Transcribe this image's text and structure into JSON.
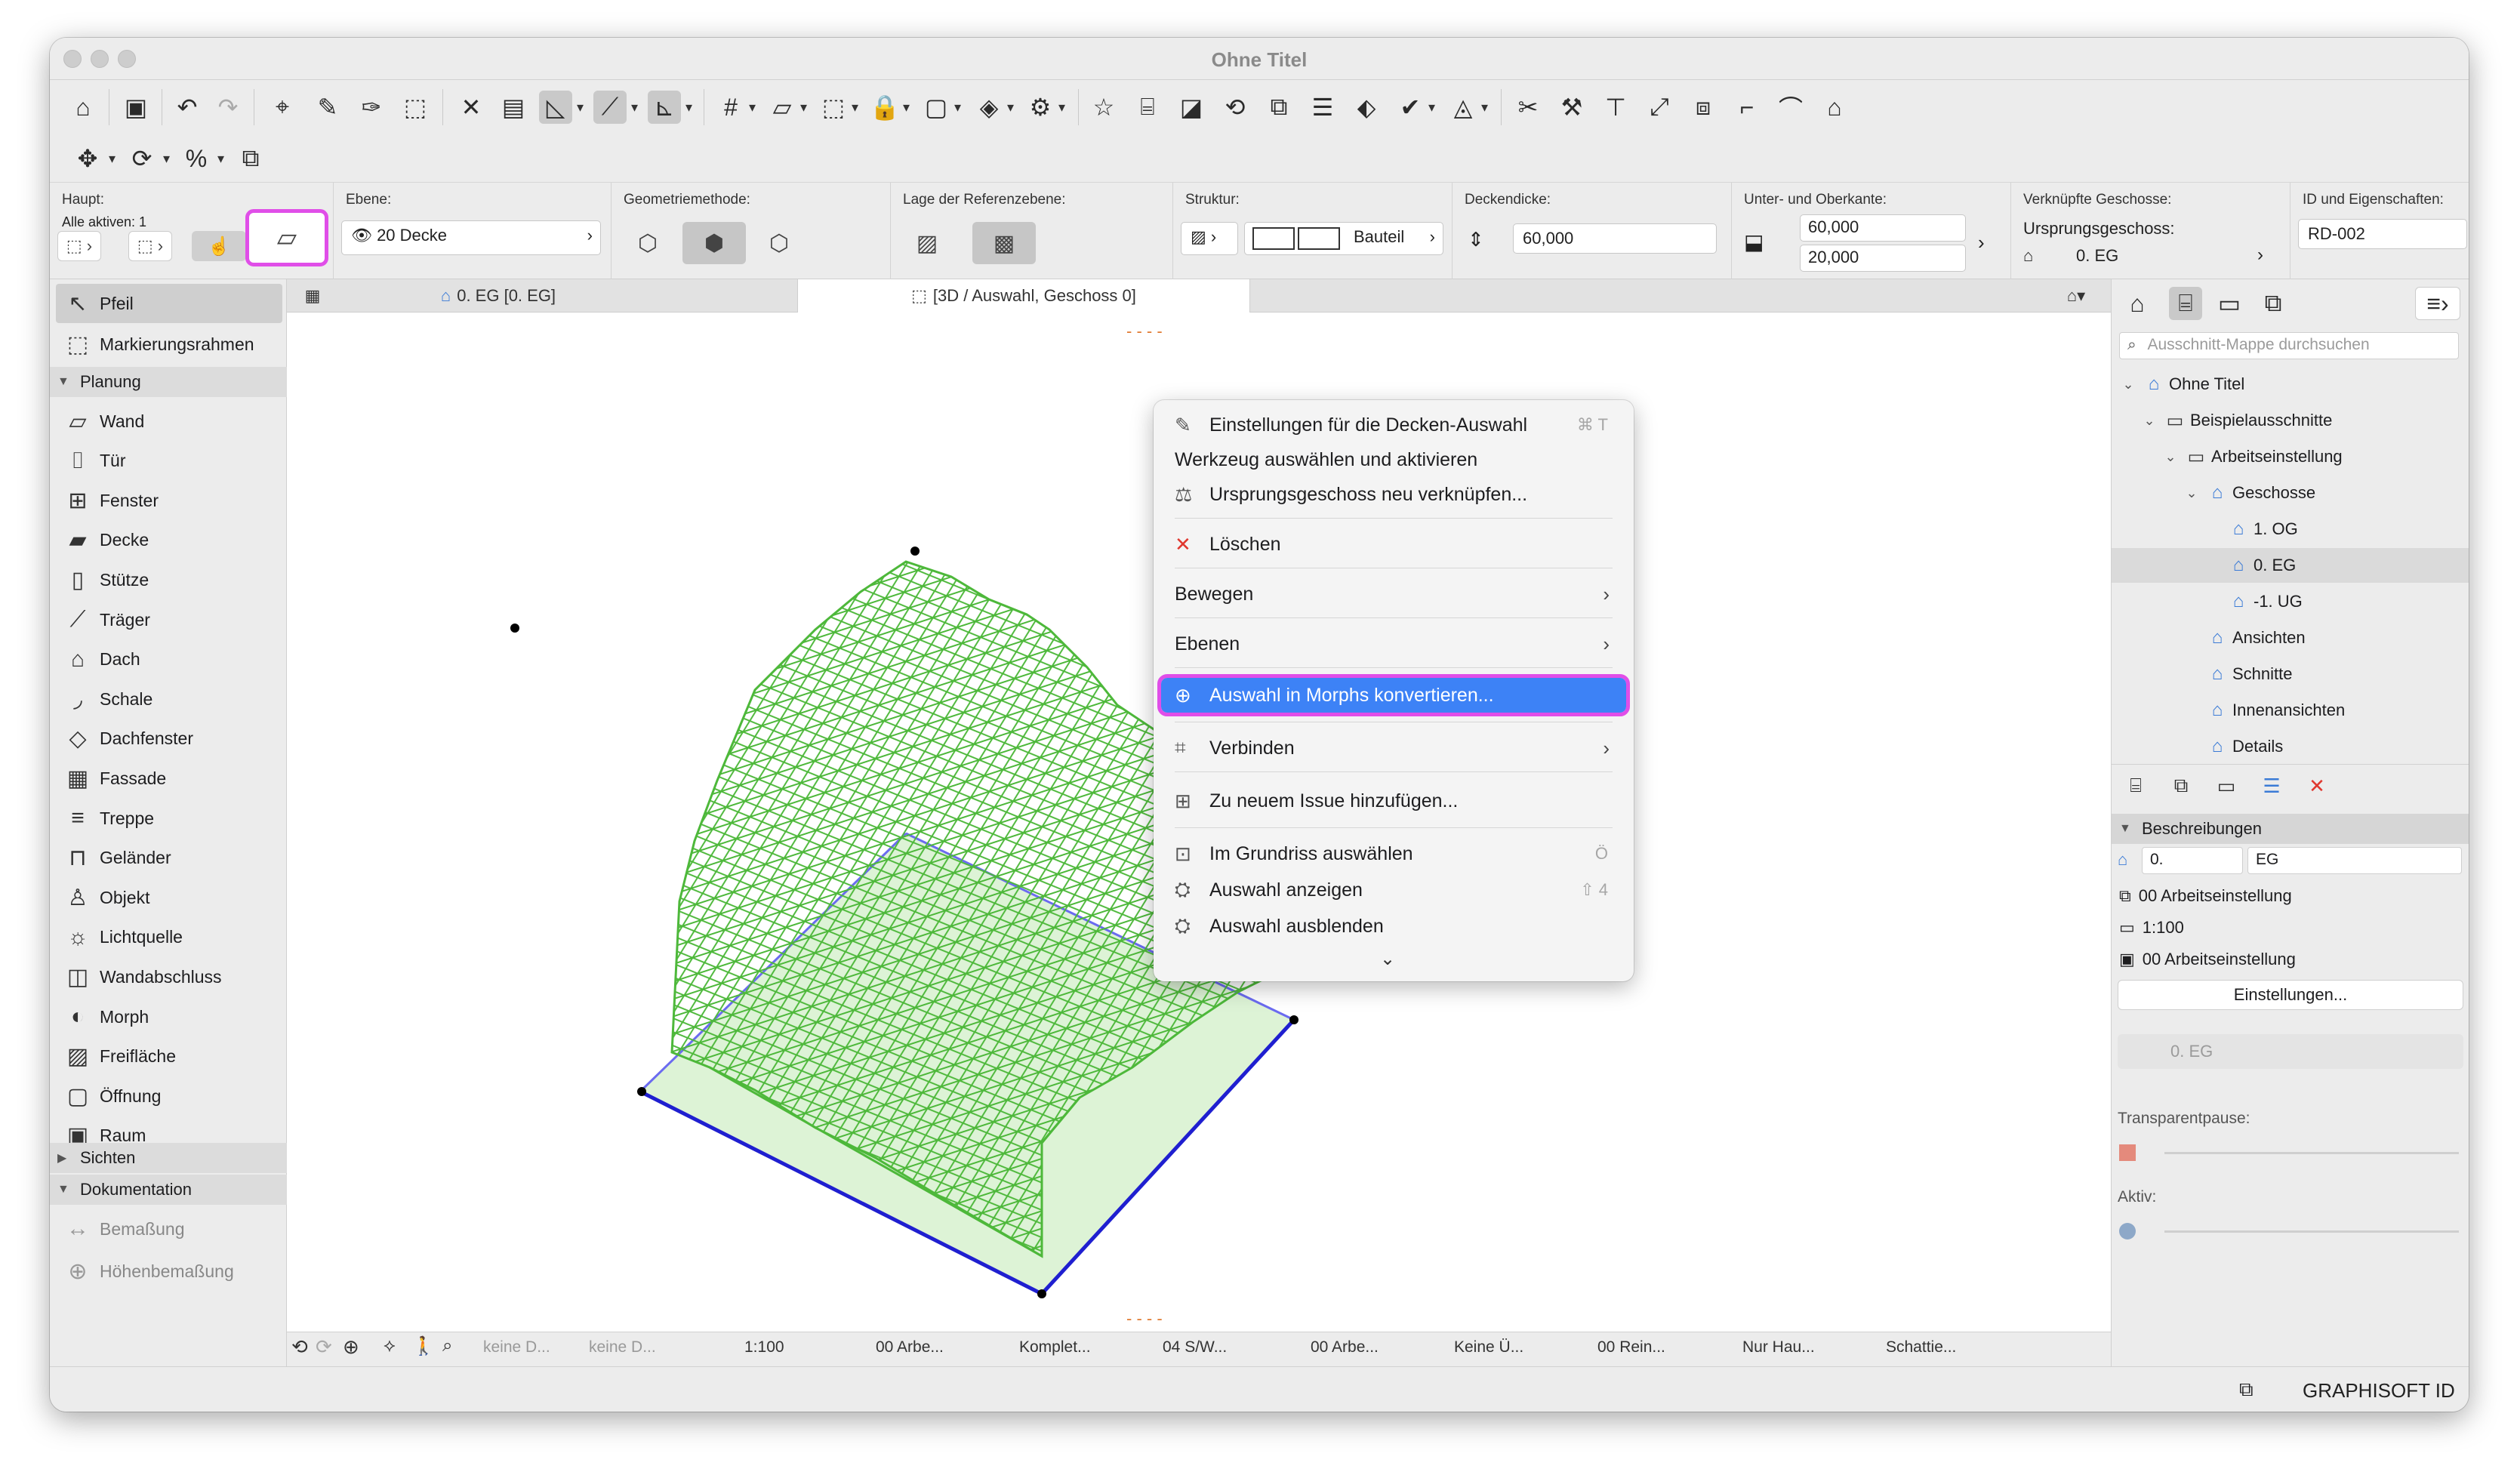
{
  "window": {
    "title": "Ohne Titel"
  },
  "infobox": {
    "haupt": {
      "label": "Haupt:",
      "alle_aktiven": "Alle aktiven: 1"
    },
    "ebene": {
      "label": "Ebene:",
      "value": "20 Decke"
    },
    "geometrie": {
      "label": "Geometriemethode:"
    },
    "referenz": {
      "label": "Lage der Referenzebene:"
    },
    "struktur": {
      "label": "Struktur:",
      "value": "Bauteil"
    },
    "deckendicke": {
      "label": "Deckendicke:",
      "value": "60,000"
    },
    "unter_ober": {
      "label": "Unter- und Oberkante:",
      "top": "60,000",
      "bottom": "20,000"
    },
    "verknuepft": {
      "label": "Verknüpfte Geschosse:",
      "ursprung_label": "Ursprungsgeschoss:",
      "ursprung_value": "0. EG"
    },
    "id": {
      "label": "ID und Eigenschaften:",
      "value": "RD-002"
    }
  },
  "tabs": [
    {
      "label": "0. EG [0. EG]"
    },
    {
      "label": "[3D / Auswahl, Geschoss 0]"
    }
  ],
  "toolbox": {
    "top_items": [
      {
        "label": "Pfeil",
        "icon": "arrow-icon"
      },
      {
        "label": "Markierungsrahmen",
        "icon": "marquee-icon"
      }
    ],
    "planung_header": "Planung",
    "planung_items": [
      {
        "label": "Wand",
        "icon": "wall-icon"
      },
      {
        "label": "Tür",
        "icon": "door-icon"
      },
      {
        "label": "Fenster",
        "icon": "window-icon"
      },
      {
        "label": "Decke",
        "icon": "slab-icon"
      },
      {
        "label": "Stütze",
        "icon": "column-icon"
      },
      {
        "label": "Träger",
        "icon": "beam-icon"
      },
      {
        "label": "Dach",
        "icon": "roof-icon"
      },
      {
        "label": "Schale",
        "icon": "shell-icon"
      },
      {
        "label": "Dachfenster",
        "icon": "skylight-icon"
      },
      {
        "label": "Fassade",
        "icon": "curtain-wall-icon"
      },
      {
        "label": "Treppe",
        "icon": "stair-icon"
      },
      {
        "label": "Geländer",
        "icon": "railing-icon"
      },
      {
        "label": "Objekt",
        "icon": "object-icon"
      },
      {
        "label": "Lichtquelle",
        "icon": "lamp-icon"
      },
      {
        "label": "Wandabschluss",
        "icon": "wall-end-icon"
      },
      {
        "label": "Morph",
        "icon": "morph-icon"
      },
      {
        "label": "Freifläche",
        "icon": "mesh-icon"
      },
      {
        "label": "Öffnung",
        "icon": "opening-icon"
      },
      {
        "label": "Raum",
        "icon": "zone-icon"
      }
    ],
    "sichten_header": "Sichten",
    "doku_header": "Dokumentation",
    "doku_items": [
      {
        "label": "Bemaßung",
        "icon": "dimension-icon"
      },
      {
        "label": "Höhenbemaßung",
        "icon": "level-dimension-icon"
      }
    ]
  },
  "context_menu": {
    "items": [
      {
        "label": "Einstellungen für die Decken-Auswahl",
        "shortcut": "⌘ T",
        "icon": "slab-settings-icon"
      },
      {
        "label": "Werkzeug auswählen und aktivieren",
        "shortcut": "",
        "icon": ""
      },
      {
        "label": "Ursprungsgeschoss neu verknüpfen...",
        "shortcut": "",
        "icon": "relink-icon"
      },
      {
        "label": "Löschen",
        "shortcut": "",
        "icon": "delete-icon"
      },
      {
        "label": "Bewegen",
        "shortcut": "",
        "icon": ""
      },
      {
        "label": "Ebenen",
        "shortcut": "",
        "icon": ""
      },
      {
        "label": "Auswahl in Morphs konvertieren...",
        "shortcut": "",
        "icon": "convert-morph-icon"
      },
      {
        "label": "Verbinden",
        "shortcut": "",
        "icon": "connect-icon"
      },
      {
        "label": "Zu neuem Issue hinzufügen...",
        "shortcut": "",
        "icon": "issue-icon"
      },
      {
        "label": "Im Grundriss auswählen",
        "shortcut": "Ö",
        "icon": "select-plan-icon"
      },
      {
        "label": "Auswahl anzeigen",
        "shortcut": "⇧ 4",
        "icon": "show-selection-icon"
      },
      {
        "label": "Auswahl ausblenden",
        "shortcut": "",
        "icon": "hide-selection-icon"
      }
    ]
  },
  "navigator": {
    "search_placeholder": "Ausschnitt-Mappe durchsuchen",
    "tree": [
      {
        "label": "Ohne Titel",
        "depth": 0
      },
      {
        "label": "Beispielausschnitte",
        "depth": 1
      },
      {
        "label": "Arbeitseinstellung",
        "depth": 2
      },
      {
        "label": "Geschosse",
        "depth": 3
      },
      {
        "label": "1. OG",
        "depth": 4
      },
      {
        "label": "0. EG",
        "depth": 4
      },
      {
        "label": "-1. UG",
        "depth": 4
      },
      {
        "label": "Ansichten",
        "depth": 3
      },
      {
        "label": "Schnitte",
        "depth": 3
      },
      {
        "label": "Innenansichten",
        "depth": 3
      },
      {
        "label": "Details",
        "depth": 3
      }
    ],
    "beschreibungen_header": "Beschreibungen",
    "id_prefix": "0.",
    "id_name": "EG",
    "layer_combo": "00 Arbeitseinstellung",
    "scale": "1:100",
    "model_view": "00 Arbeitseinstellung",
    "settings_button": "Einstellungen...",
    "view_field": "0. EG",
    "transparent_label": "Transparentpause:",
    "aktiv_label": "Aktiv:"
  },
  "statusbar": [
    {
      "label": "keine D...",
      "dim": true
    },
    {
      "label": "keine D...",
      "dim": true
    },
    {
      "label": "1:100",
      "dim": false
    },
    {
      "label": "00 Arbe...",
      "dim": false
    },
    {
      "label": "Komplet...",
      "dim": false
    },
    {
      "label": "04 S/W...",
      "dim": false
    },
    {
      "label": "00 Arbe...",
      "dim": false
    },
    {
      "label": "Keine Ü...",
      "dim": false
    },
    {
      "label": "00 Rein...",
      "dim": false
    },
    {
      "label": "Nur Hau...",
      "dim": false
    },
    {
      "label": "Schattie...",
      "dim": false
    }
  ],
  "brand": "GRAPHISOFT ID",
  "colors": {
    "accent": "#3d82f6",
    "highlight_outline": "#e04ee8",
    "mesh": "#4db83a",
    "selection": "#1f1fd0"
  }
}
